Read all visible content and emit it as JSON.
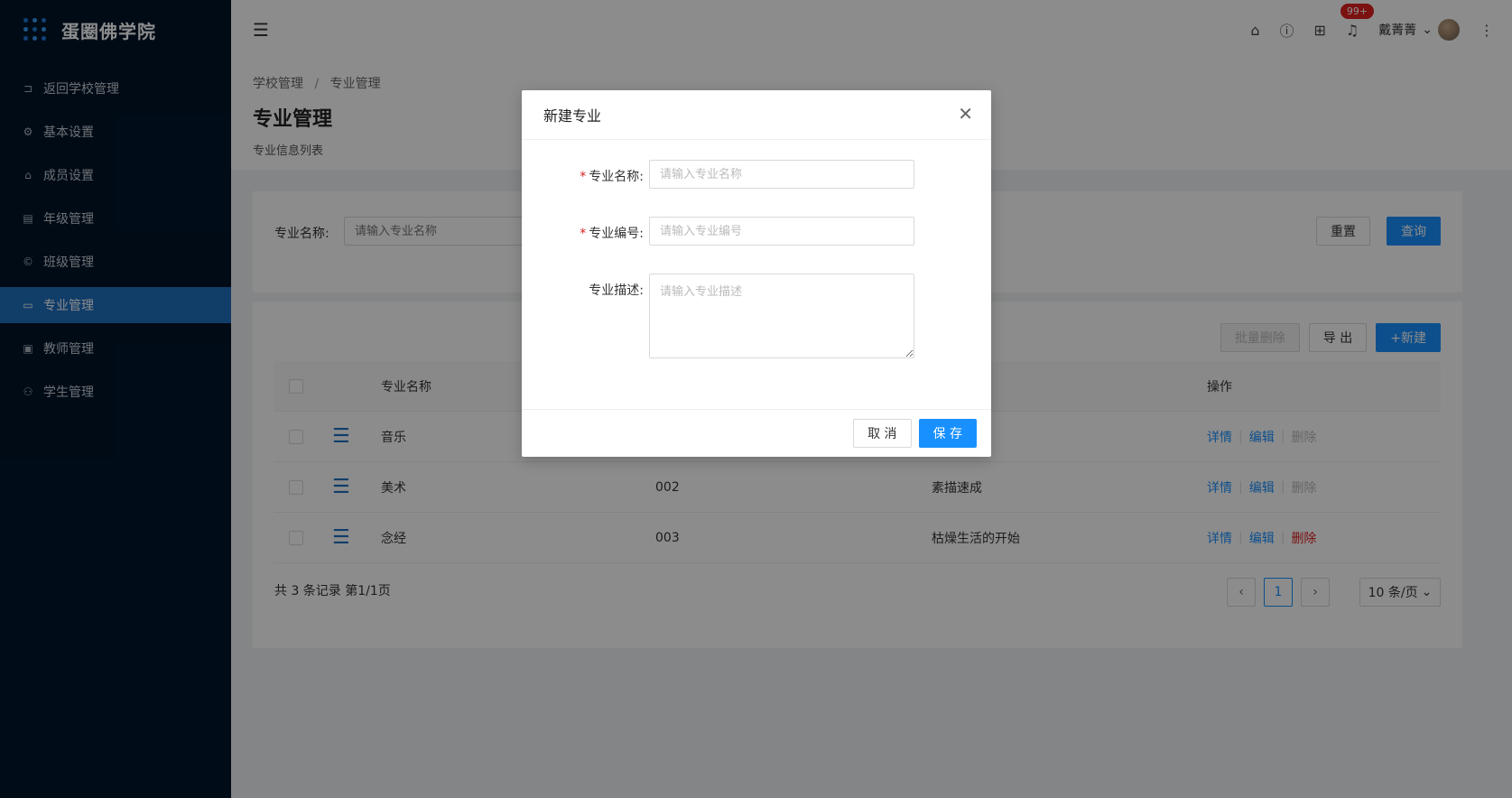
{
  "app": {
    "title": "蛋圈佛学院"
  },
  "sidebar": {
    "items": [
      {
        "label": "返回学校管理",
        "icon": "return-icon"
      },
      {
        "label": "基本设置",
        "icon": "gear-icon"
      },
      {
        "label": "成员设置",
        "icon": "home-icon"
      },
      {
        "label": "年级管理",
        "icon": "grade-icon"
      },
      {
        "label": "班级管理",
        "icon": "copyright-icon"
      },
      {
        "label": "专业管理",
        "icon": "laptop-icon",
        "active": true
      },
      {
        "label": "教师管理",
        "icon": "id-card-icon"
      },
      {
        "label": "学生管理",
        "icon": "user-icon"
      }
    ]
  },
  "header": {
    "notification_badge": "99+",
    "user_name": "戴菁菁"
  },
  "page": {
    "breadcrumb": [
      "学校管理",
      "专业管理"
    ],
    "title": "专业管理",
    "subtitle": "专业信息列表"
  },
  "search": {
    "label": "专业名称:",
    "placeholder": "请输入专业名称",
    "reset_label": "重置",
    "query_label": "查询"
  },
  "toolbar": {
    "batch_delete_label": "批量删除",
    "export_label": "导 出",
    "new_label": "+新建"
  },
  "table": {
    "columns": [
      "专业名称",
      "",
      "",
      "操作"
    ],
    "rows": [
      {
        "name": "音乐",
        "code": "",
        "desc": "",
        "delete_enabled": false
      },
      {
        "name": "美术",
        "code": "002",
        "desc": "素描速成",
        "delete_enabled": false
      },
      {
        "name": "念经",
        "code": "003",
        "desc": "枯燥生活的开始",
        "delete_enabled": true
      }
    ],
    "ops": {
      "detail": "详情",
      "edit": "编辑",
      "delete": "删除"
    }
  },
  "pagination": {
    "total_text": "共 3 条记录 第1/1页",
    "current_page": "1",
    "page_size": "10 条/页"
  },
  "modal": {
    "title": "新建专业",
    "fields": [
      {
        "label": "专业名称:",
        "placeholder": "请输入专业名称",
        "required": true
      },
      {
        "label": "专业编号:",
        "placeholder": "请输入专业编号",
        "required": true
      },
      {
        "label": "专业描述:",
        "placeholder": "请输入专业描述",
        "required": false
      }
    ],
    "cancel_label": "取 消",
    "save_label": "保 存"
  },
  "colors": {
    "primary": "#1890ff",
    "sidebar_bg": "#001529",
    "sidebar_active": "#1f6fbf",
    "danger": "#e02020"
  }
}
